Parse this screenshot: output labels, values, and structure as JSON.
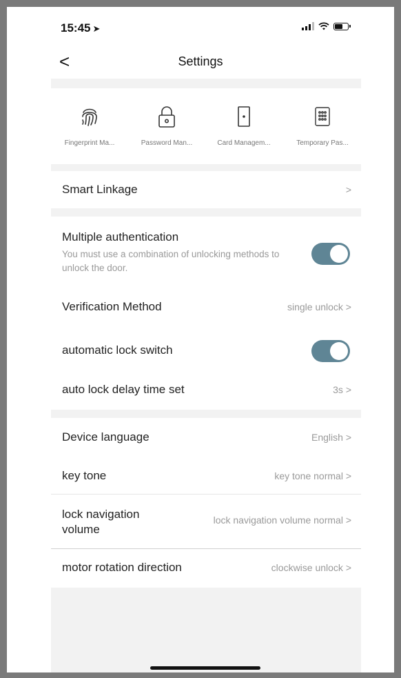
{
  "status_bar": {
    "time": "15:45",
    "location_arrow": "➤"
  },
  "nav": {
    "back_label": "<",
    "title": "Settings"
  },
  "quick_actions": [
    {
      "icon": "fingerprint-icon",
      "label": "Fingerprint Ma..."
    },
    {
      "icon": "lock-icon",
      "label": "Password Man..."
    },
    {
      "icon": "door-icon",
      "label": "Card Managem..."
    },
    {
      "icon": "keypad-icon",
      "label": "Temporary Pas..."
    }
  ],
  "smart_linkage": {
    "label": "Smart Linkage",
    "chevron": ">"
  },
  "multiple_auth": {
    "label": "Multiple authentication",
    "description": "You must use a combination of unlocking methods to unlock the door.",
    "enabled": true
  },
  "verification_method": {
    "label": "Verification Method",
    "value": "single unlock >"
  },
  "auto_lock_switch": {
    "label": "automatic lock switch",
    "enabled": true
  },
  "auto_lock_delay": {
    "label": "auto lock delay time set",
    "value": "3s >"
  },
  "device_language": {
    "label": "Device language",
    "value": "English >"
  },
  "key_tone": {
    "label": "key tone",
    "value": "key tone normal >"
  },
  "lock_navigation": {
    "label": "lock navigation volume",
    "value": "lock navigation volume normal >"
  },
  "motor_rotation": {
    "label": "motor rotation direction",
    "value": "clockwise unlock >"
  },
  "colors": {
    "toggle_on": "#5f8595",
    "band": "#f2f2f2",
    "muted_text": "#999999"
  }
}
